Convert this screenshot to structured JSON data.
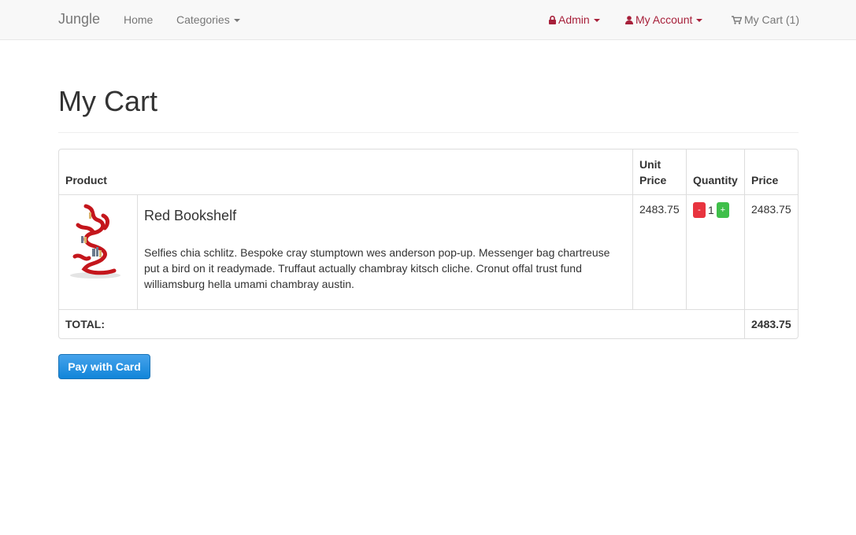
{
  "navbar": {
    "brand": "Jungle",
    "home_label": "Home",
    "categories_label": "Categories",
    "admin_label": "Admin",
    "account_label": "My Account",
    "cart_label": "My Cart (1)"
  },
  "page": {
    "title": "My Cart"
  },
  "cart_table": {
    "headers": {
      "product": "Product",
      "unit_price_line1": "Unit",
      "unit_price_line2": "Price",
      "quantity": "Quantity",
      "price": "Price"
    },
    "items": [
      {
        "name": "Red Bookshelf",
        "description": "Selfies chia schlitz. Bespoke cray stumptown wes anderson pop-up. Messenger bag chartreuse put a bird on it readymade. Truffaut actually chambray kitsch cliche. Cronut offal trust fund williamsburg hella umami chambray austin.",
        "unit_price": "2483.75",
        "quantity": "1",
        "minus_label": "-",
        "plus_label": "+",
        "price": "2483.75"
      }
    ],
    "total_label": "TOTAL:",
    "total_value": "2483.75"
  },
  "checkout": {
    "pay_label": "Pay with Card"
  }
}
